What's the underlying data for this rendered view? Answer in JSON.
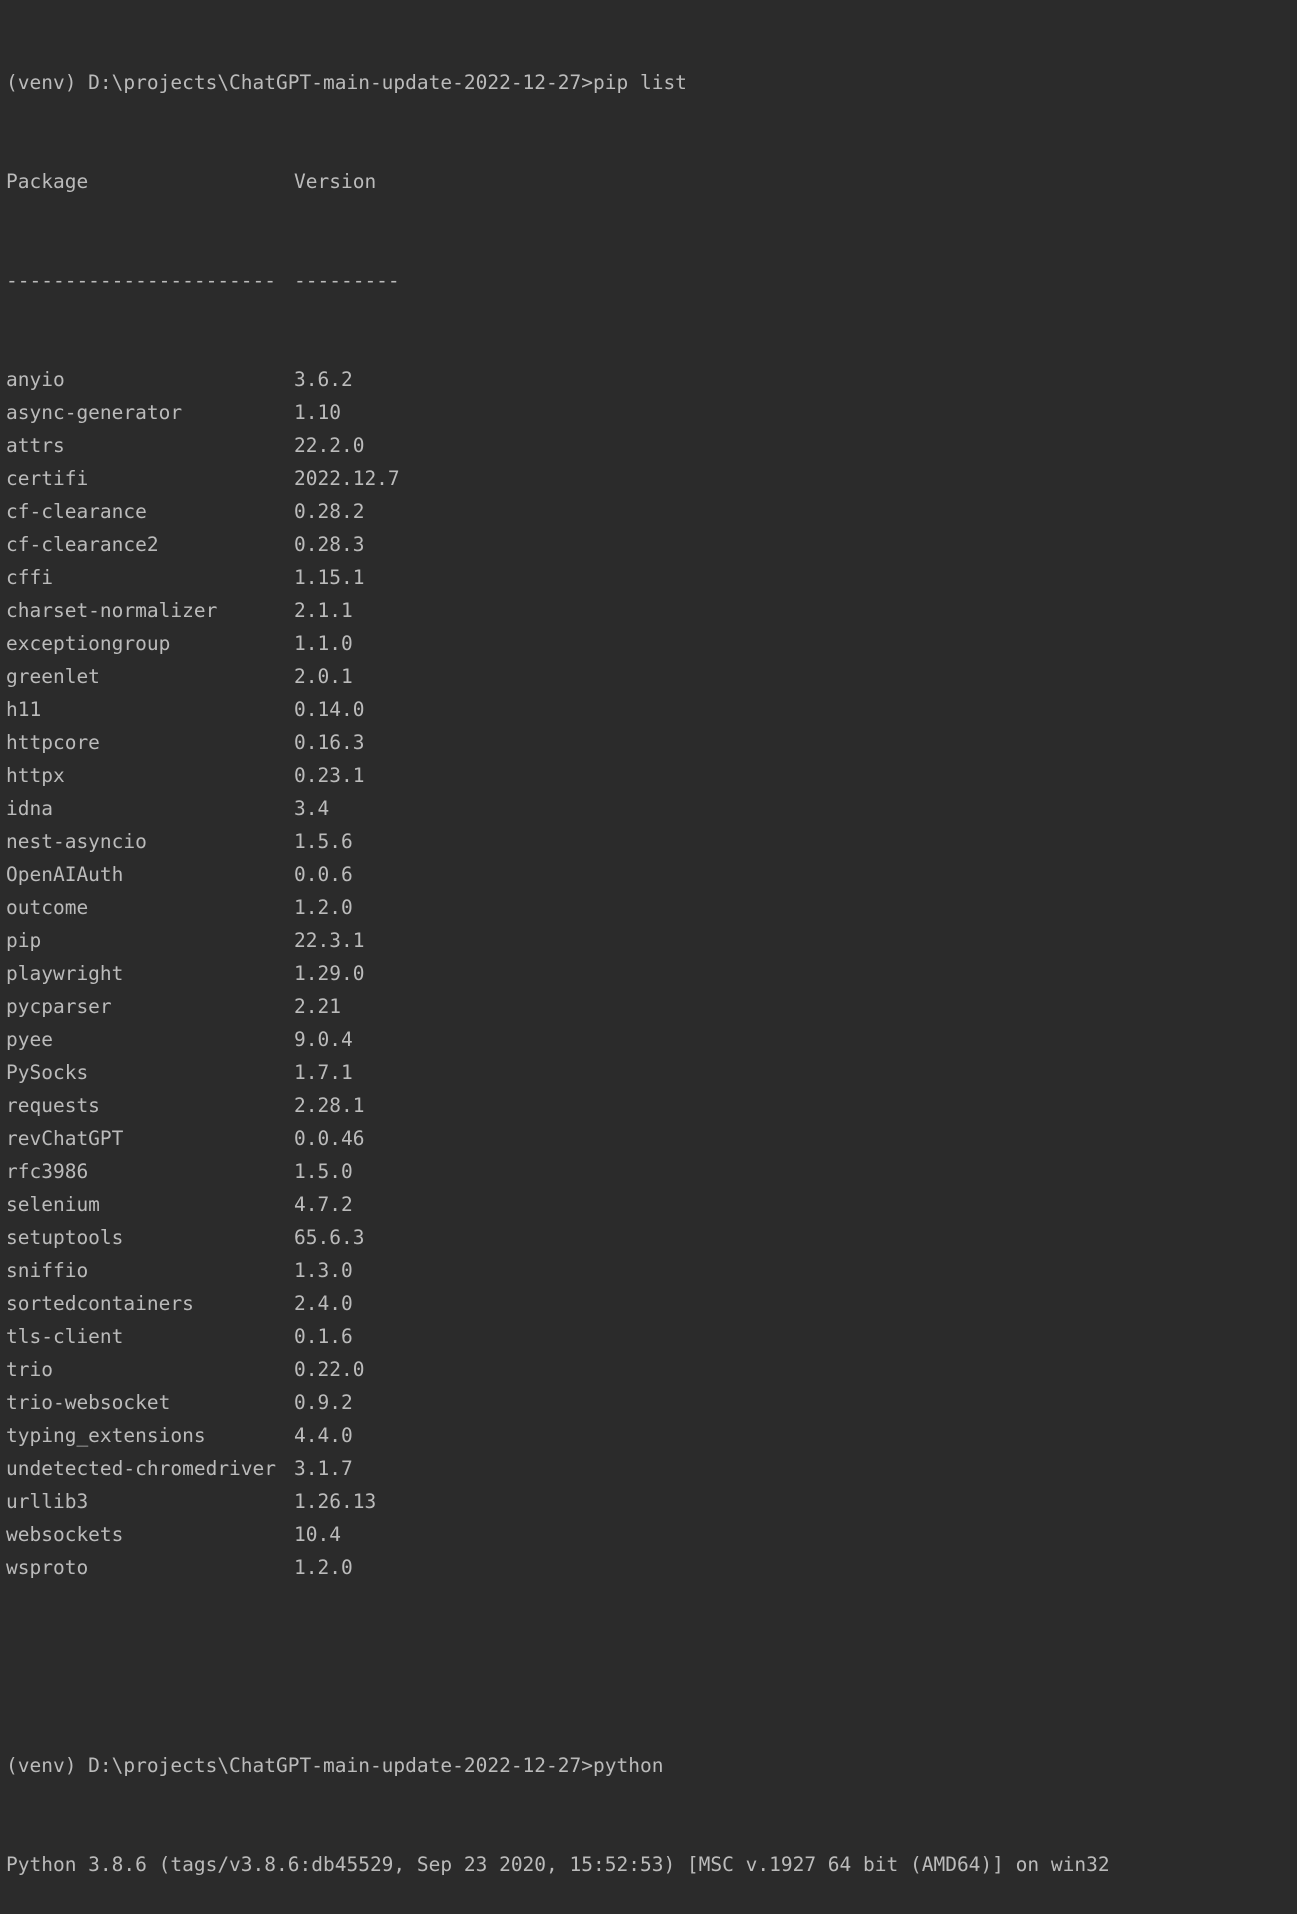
{
  "terminal": {
    "prompt1": "(venv) D:\\projects\\ChatGPT-main-update-2022-12-27>pip list",
    "header": {
      "package": "Package",
      "version": "Version"
    },
    "separator": {
      "package": "-----------------------",
      "version": "---------"
    },
    "packages": [
      {
        "name": "anyio",
        "version": "3.6.2"
      },
      {
        "name": "async-generator",
        "version": "1.10"
      },
      {
        "name": "attrs",
        "version": "22.2.0"
      },
      {
        "name": "certifi",
        "version": "2022.12.7"
      },
      {
        "name": "cf-clearance",
        "version": "0.28.2"
      },
      {
        "name": "cf-clearance2",
        "version": "0.28.3"
      },
      {
        "name": "cffi",
        "version": "1.15.1"
      },
      {
        "name": "charset-normalizer",
        "version": "2.1.1"
      },
      {
        "name": "exceptiongroup",
        "version": "1.1.0"
      },
      {
        "name": "greenlet",
        "version": "2.0.1"
      },
      {
        "name": "h11",
        "version": "0.14.0"
      },
      {
        "name": "httpcore",
        "version": "0.16.3"
      },
      {
        "name": "httpx",
        "version": "0.23.1"
      },
      {
        "name": "idna",
        "version": "3.4"
      },
      {
        "name": "nest-asyncio",
        "version": "1.5.6"
      },
      {
        "name": "OpenAIAuth",
        "version": "0.0.6"
      },
      {
        "name": "outcome",
        "version": "1.2.0"
      },
      {
        "name": "pip",
        "version": "22.3.1"
      },
      {
        "name": "playwright",
        "version": "1.29.0"
      },
      {
        "name": "pycparser",
        "version": "2.21"
      },
      {
        "name": "pyee",
        "version": "9.0.4"
      },
      {
        "name": "PySocks",
        "version": "1.7.1"
      },
      {
        "name": "requests",
        "version": "2.28.1"
      },
      {
        "name": "revChatGPT",
        "version": "0.0.46"
      },
      {
        "name": "rfc3986",
        "version": "1.5.0"
      },
      {
        "name": "selenium",
        "version": "4.7.2"
      },
      {
        "name": "setuptools",
        "version": "65.6.3"
      },
      {
        "name": "sniffio",
        "version": "1.3.0"
      },
      {
        "name": "sortedcontainers",
        "version": "2.4.0"
      },
      {
        "name": "tls-client",
        "version": "0.1.6"
      },
      {
        "name": "trio",
        "version": "0.22.0"
      },
      {
        "name": "trio-websocket",
        "version": "0.9.2"
      },
      {
        "name": "typing_extensions",
        "version": "4.4.0"
      },
      {
        "name": "undetected-chromedriver",
        "version": "3.1.7"
      },
      {
        "name": "urllib3",
        "version": "1.26.13"
      },
      {
        "name": "websockets",
        "version": "10.4"
      },
      {
        "name": "wsproto",
        "version": "1.2.0"
      }
    ],
    "prompt2": "(venv) D:\\projects\\ChatGPT-main-update-2022-12-27>python",
    "python_banner": "Python 3.8.6 (tags/v3.8.6:db45529, Sep 23 2020, 15:52:53) [MSC v.1927 64 bit (AMD64)] on win32"
  }
}
